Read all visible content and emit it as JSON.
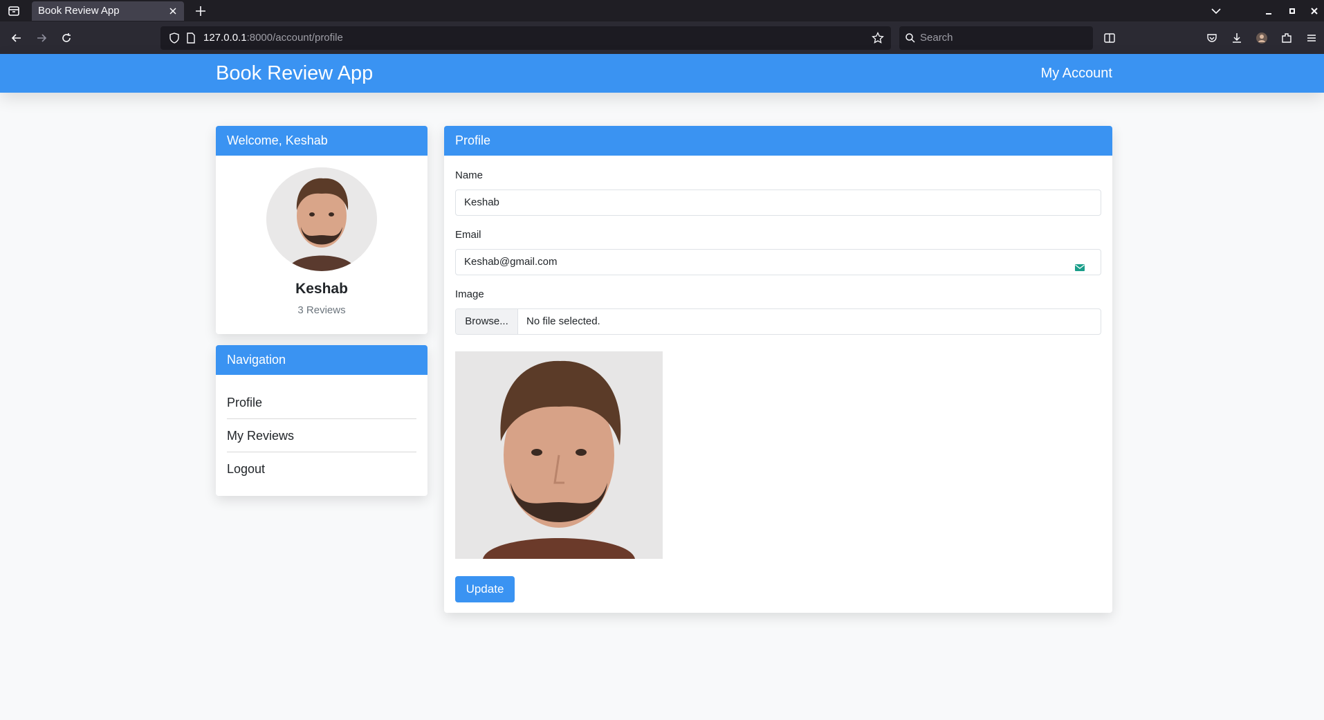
{
  "browser": {
    "tab_title": "Book Review App",
    "url_host": "127.0.0.1",
    "url_path": ":8000/account/profile",
    "search_placeholder": "Search"
  },
  "header": {
    "brand": "Book Review App",
    "account_link": "My Account"
  },
  "welcome_card": {
    "title": "Welcome, Keshab",
    "user_name": "Keshab",
    "review_count": "3 Reviews"
  },
  "navigation": {
    "title": "Navigation",
    "items": [
      {
        "label": "Profile"
      },
      {
        "label": "My Reviews"
      },
      {
        "label": "Logout"
      }
    ]
  },
  "profile_form": {
    "title": "Profile",
    "name_label": "Name",
    "name_value": "Keshab",
    "email_label": "Email",
    "email_value": "Keshab@gmail.com",
    "image_label": "Image",
    "browse_label": "Browse...",
    "file_status": "No file selected.",
    "update_label": "Update"
  },
  "colors": {
    "primary": "#3a93f2",
    "page_bg": "#f8f9fa",
    "browser_dark": "#2b2a33"
  }
}
